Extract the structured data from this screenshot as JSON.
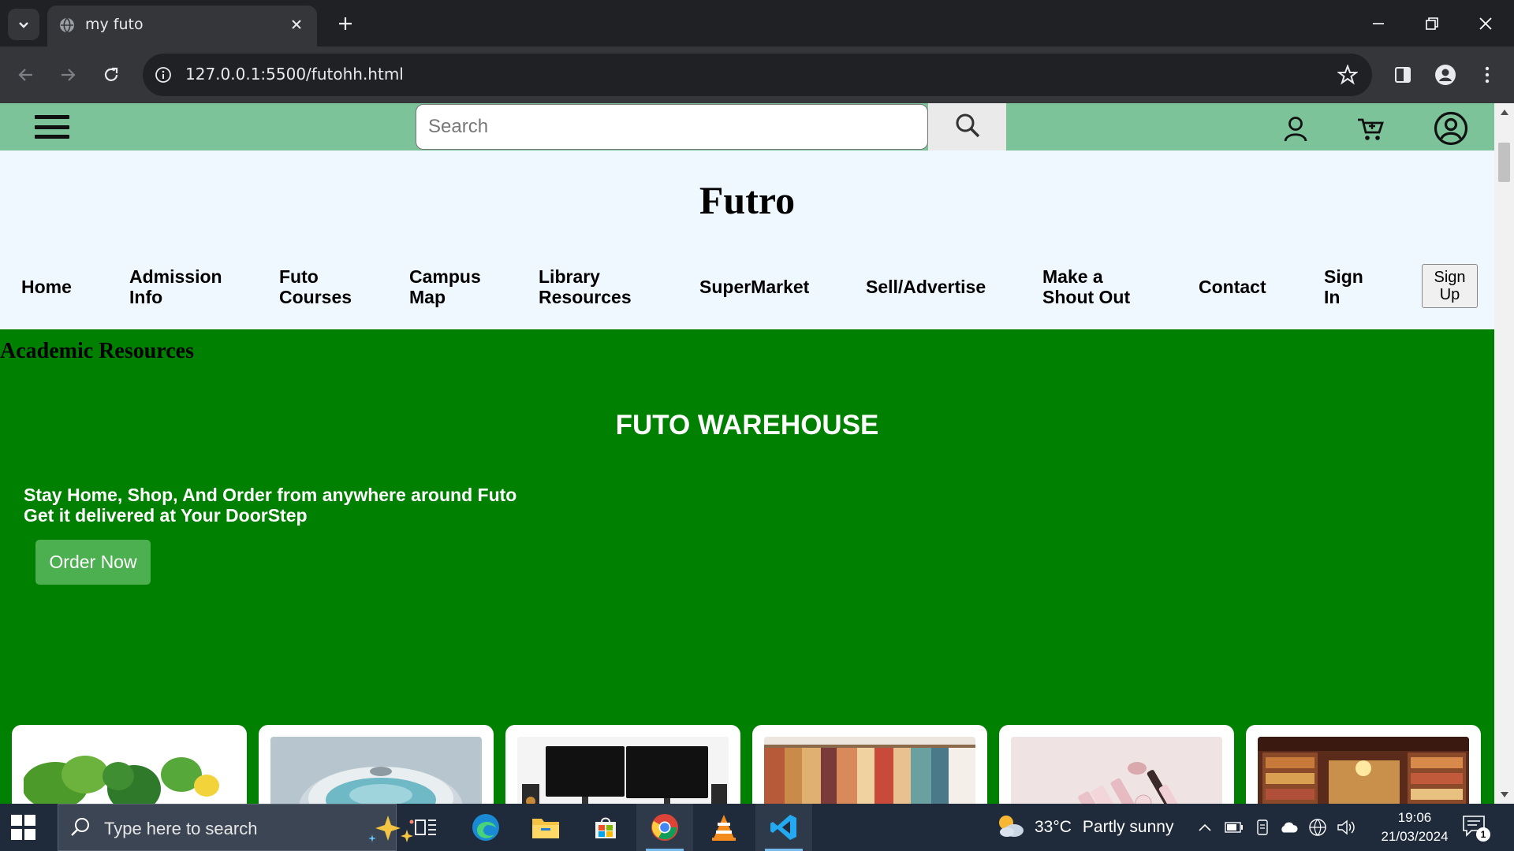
{
  "browser": {
    "tab_title": "my futo",
    "url": "127.0.0.1:5500/futohh.html"
  },
  "site": {
    "search_placeholder": "Search",
    "brand": "Futro",
    "nav": [
      {
        "label": "Home"
      },
      {
        "label": "Admission Info"
      },
      {
        "label": "Futo Courses"
      },
      {
        "label": "Campus Map"
      },
      {
        "label": "Library Resources"
      },
      {
        "label": "SuperMarket"
      },
      {
        "label": "Sell/Advertise"
      },
      {
        "label": "Make a Shout Out"
      },
      {
        "label": "Contact"
      },
      {
        "label": "Sign In"
      }
    ],
    "signup_label": "Sign Up",
    "section_label": "Academic Resources",
    "warehouse_title": "FUTO WAREHOUSE",
    "tagline_line1": "Stay Home, Shop, And Order from anywhere around Futo",
    "tagline_line2": "Get it delivered at Your DoorStep",
    "order_button": "Order Now",
    "categories": [
      {
        "image": "vegetables"
      },
      {
        "image": "cookware-pots"
      },
      {
        "image": "computer-monitors"
      },
      {
        "image": "clothing-rack"
      },
      {
        "image": "beauty-products"
      },
      {
        "image": "bookshop"
      }
    ],
    "colors": {
      "topbar": "#7cc399",
      "header_bg": "#f0f8ff",
      "main_bg": "#008000",
      "order_button": "#4caf50"
    }
  },
  "taskbar": {
    "search_placeholder": "Type here to search",
    "weather_temp": "33°C",
    "weather_condition": "Partly sunny",
    "time": "19:06",
    "date": "21/03/2024",
    "notification_count": "1"
  }
}
